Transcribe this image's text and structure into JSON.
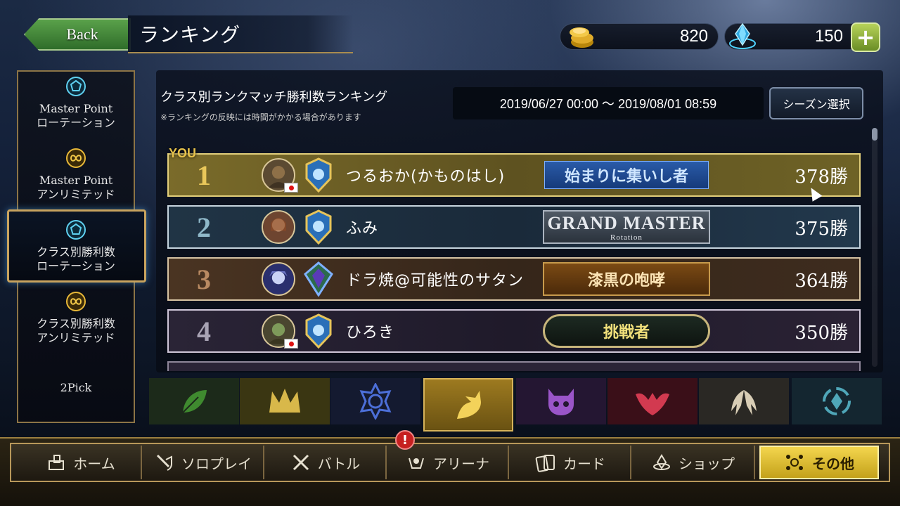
{
  "header": {
    "back_label": "Back",
    "title": "ランキング",
    "gold": "820",
    "crystals": "150"
  },
  "sidebar": {
    "items": [
      {
        "line1": "Master Point",
        "line2": "ローテーション",
        "icon": "pentagon-icon"
      },
      {
        "line1": "Master Point",
        "line2": "アンリミテッド",
        "icon": "infinity-icon"
      },
      {
        "line1": "クラス別勝利数",
        "line2": "ローテーション",
        "icon": "pentagon-icon",
        "active": true
      },
      {
        "line1": "クラス別勝利数",
        "line2": "アンリミテッド",
        "icon": "infinity-icon"
      },
      {
        "line1": "2Pick",
        "line2": ""
      }
    ]
  },
  "ranking": {
    "title": "クラス別ランクマッチ勝利数ランキング",
    "note": "※ランキングの反映には時間がかかる場合があります",
    "season_range": "2019/06/27 00:00 〜 2019/08/01 08:59",
    "season_button": "シーズン選択",
    "you_label": "YOU",
    "rows": [
      {
        "rank": "1",
        "name": "つるおか(かものはし)",
        "badge": "始まりに集いし者",
        "wins": "378勝",
        "num_color": "#e9c75a"
      },
      {
        "rank": "2",
        "name": "ふみ",
        "badge": "GRAND MASTER",
        "badge_sub": "Rotation",
        "wins": "375勝",
        "num_color": "#8fb8c9"
      },
      {
        "rank": "3",
        "name": "ドラ焼@可能性のサタン",
        "badge": "漆黒の咆哮",
        "wins": "364勝",
        "num_color": "#b98a62"
      },
      {
        "rank": "4",
        "name": "ひろき",
        "badge": "挑戦者",
        "wins": "350勝",
        "num_color": "#a8a3b4"
      }
    ]
  },
  "class_tabs": [
    {
      "name": "forestcraft",
      "icon": "leaf-icon",
      "color": "#3f8a2f"
    },
    {
      "name": "swordcraft",
      "icon": "crown-icon",
      "color": "#d8b84a"
    },
    {
      "name": "runecraft",
      "icon": "rune-star-icon",
      "color": "#4c6fd8"
    },
    {
      "name": "dragoncraft",
      "icon": "dragon-icon",
      "color": "#f3d25a",
      "active": true
    },
    {
      "name": "shadowcraft",
      "icon": "skull-icon",
      "color": "#9a55c8"
    },
    {
      "name": "bloodcraft",
      "icon": "bat-icon",
      "color": "#d23a50"
    },
    {
      "name": "havencraft",
      "icon": "wings-icon",
      "color": "#d8cdb5"
    },
    {
      "name": "portalcraft",
      "icon": "portal-icon",
      "color": "#4fa6b8"
    }
  ],
  "nav": {
    "items": [
      {
        "label": "ホーム",
        "icon": "home-icon"
      },
      {
        "label": "ソロプレイ",
        "icon": "sword-shield-icon"
      },
      {
        "label": "バトル",
        "icon": "crossed-swords-icon"
      },
      {
        "label": "アリーナ",
        "icon": "arena-icon",
        "notify": "!"
      },
      {
        "label": "カード",
        "icon": "cards-icon"
      },
      {
        "label": "ショップ",
        "icon": "shop-icon"
      },
      {
        "label": "その他",
        "icon": "other-icon",
        "active": true
      }
    ]
  }
}
